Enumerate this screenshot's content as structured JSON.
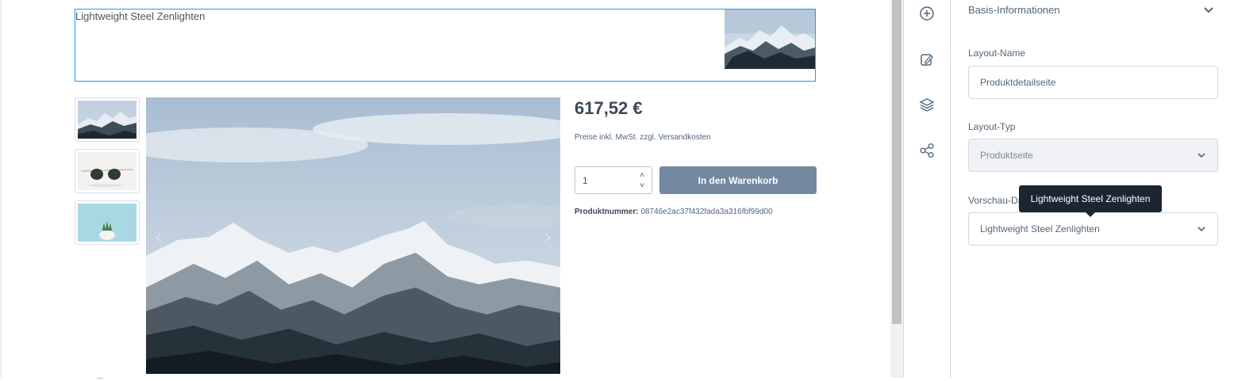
{
  "product": {
    "name": "Lightweight Steel Zenlighten",
    "price": "617,52 €",
    "tax_note": "Preise inkl. MwSt. zzgl. Versandkosten",
    "quantity": "1",
    "cart_button": "In den Warenkorb",
    "product_number_label": "Produktnummer:",
    "product_number": "08746e2ac37f432fada3a316fbf99d00",
    "thumbnails": [
      "mountain-image",
      "sunglasses-image",
      "plant-image"
    ],
    "bottom_snippet": "..."
  },
  "sidebar": {
    "icons": [
      "plus-circle-icon",
      "edit-icon",
      "layers-icon",
      "share-icon"
    ]
  },
  "panel": {
    "section_title": "Basis-Informationen",
    "layout_name_label": "Layout-Name",
    "layout_name_value": "Produktdetailseite",
    "layout_type_label": "Layout-Typ",
    "layout_type_value": "Produktseite",
    "preview_label": "Vorschau-Da",
    "preview_value": "Lightweight Steel Zenlighten"
  },
  "tooltip": {
    "text": "Lightweight Steel Zenlighten"
  },
  "colors": {
    "accent": "#189eff",
    "button": "#7489a0",
    "tooltip_bg": "#1c2531",
    "text": "#52667a"
  }
}
